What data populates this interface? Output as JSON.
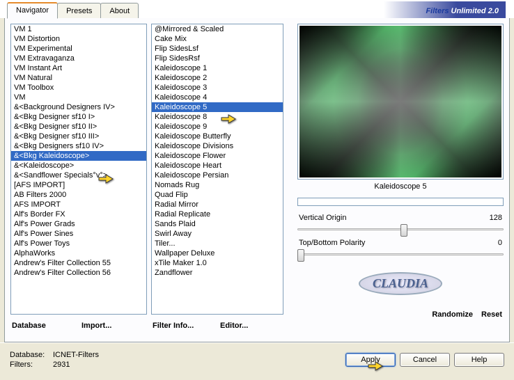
{
  "title_a": "Filters ",
  "title_b": "Unlimited 2.0",
  "tabs": [
    "Navigator",
    "Presets",
    "About"
  ],
  "active_tab": 0,
  "categories": [
    "VM 1",
    "VM Distortion",
    "VM Experimental",
    "VM Extravaganza",
    "VM Instant Art",
    "VM Natural",
    "VM Toolbox",
    "VM",
    "&<Background Designers IV>",
    "&<Bkg Designer sf10 I>",
    "&<Bkg Designer sf10 II>",
    "&<Bkg Designer sf10 III>",
    "&<Bkg Designers sf10 IV>",
    "&<Bkg Kaleidoscope>",
    "&<Kaleidoscope>",
    "&<Sandflower Specials°v°>",
    "[AFS IMPORT]",
    "AB Filters 2000",
    "AFS IMPORT",
    "Alf's Border FX",
    "Alf's Power Grads",
    "Alf's Power Sines",
    "Alf's Power Toys",
    "AlphaWorks",
    "Andrew's Filter Collection 55",
    "Andrew's Filter Collection 56"
  ],
  "selected_category_index": 13,
  "filters": [
    "@Mirrored & Scaled",
    "Cake Mix",
    "Flip SidesLsf",
    "Flip SidesRsf",
    "Kaleidoscope 1",
    "Kaleidoscope 2",
    "Kaleidoscope 3",
    "Kaleidoscope 4",
    "Kaleidoscope 5",
    "Kaleidoscope 8",
    "Kaleidoscope 9",
    "Kaleidoscope Butterfly",
    "Kaleidoscope Divisions",
    "Kaleidoscope Flower",
    "Kaleidoscope Heart",
    "Kaleidoscope Persian",
    "Nomads Rug",
    "Quad Flip",
    "Radial Mirror",
    "Radial Replicate",
    "Sands Plaid",
    "Swirl Away",
    "Tiler...",
    "Wallpaper Deluxe",
    "xTile Maker 1.0",
    "Zandflower"
  ],
  "selected_filter_index": 8,
  "preview_label": "Kaleidoscope 5",
  "params": [
    {
      "name": "Vertical Origin",
      "value": "128"
    },
    {
      "name": "Top/Bottom Polarity",
      "value": "0"
    }
  ],
  "buttons": {
    "database": "Database",
    "import": "Import...",
    "filter_info": "Filter Info...",
    "editor": "Editor...",
    "randomize": "Randomize",
    "reset": "Reset",
    "apply": "Apply",
    "cancel": "Cancel",
    "help": "Help"
  },
  "footer": {
    "db_label": "Database:",
    "db_value": "ICNET-Filters",
    "filters_label": "Filters:",
    "filters_value": "2931"
  },
  "badge": "CLAUDIA"
}
